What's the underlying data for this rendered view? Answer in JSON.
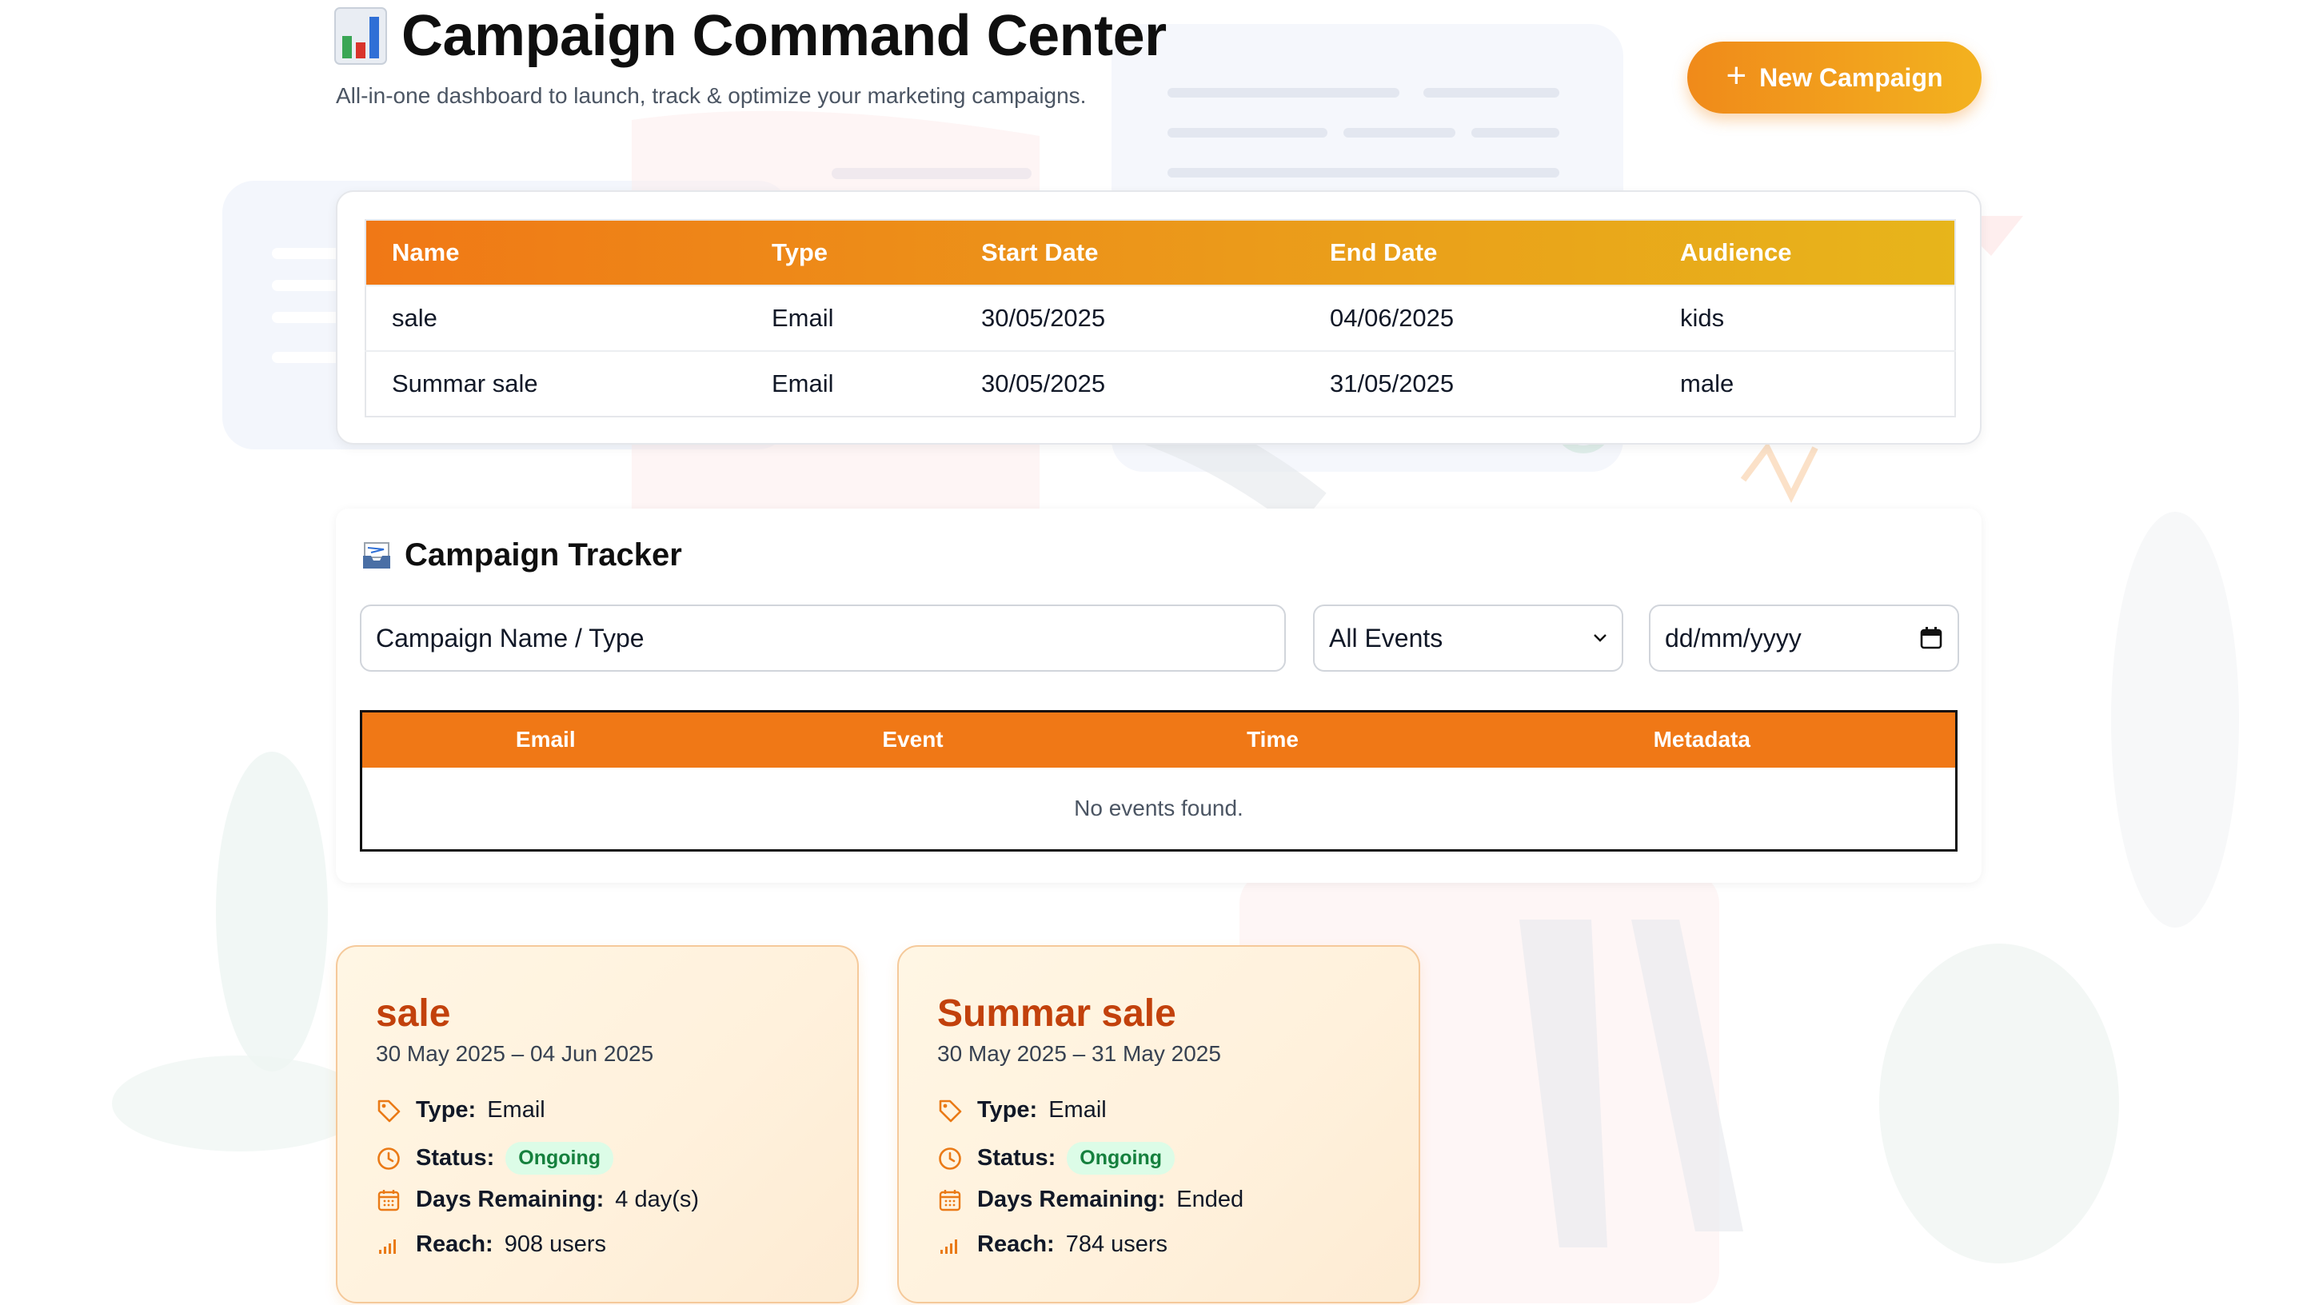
{
  "header": {
    "title": "Campaign Command Center",
    "subtitle": "All-in-one dashboard to launch, track & optimize your marketing campaigns.",
    "new_button": "New Campaign"
  },
  "campaigns_table": {
    "columns": [
      "Name",
      "Type",
      "Start Date",
      "End Date",
      "Audience"
    ],
    "rows": [
      [
        "sale",
        "Email",
        "30/05/2025",
        "04/06/2025",
        "kids"
      ],
      [
        "Summar sale",
        "Email",
        "30/05/2025",
        "31/05/2025",
        "male"
      ]
    ]
  },
  "tracker": {
    "title": "Campaign Tracker",
    "search_value": "Campaign Name / Type",
    "event_filter": "All Events",
    "date_value": "dd/mm/yyyy",
    "columns": [
      "Email",
      "Event",
      "Time",
      "Metadata"
    ],
    "empty_message": "No events found."
  },
  "cards": [
    {
      "name": "sale",
      "dates": "30 May 2025 – 04 Jun 2025",
      "type_label": "Type:",
      "type": "Email",
      "status_label": "Status:",
      "status": "Ongoing",
      "days_label": "Days Remaining:",
      "days": "4 day(s)",
      "reach_label": "Reach:",
      "reach": "908 users"
    },
    {
      "name": "Summar sale",
      "dates": "30 May 2025 – 31 May 2025",
      "type_label": "Type:",
      "type": "Email",
      "status_label": "Status:",
      "status": "Ongoing",
      "days_label": "Days Remaining:",
      "days": "Ended",
      "reach_label": "Reach:",
      "reach": "784 users"
    }
  ],
  "colors": {
    "accent": "#f07816",
    "accent_light": "#f3b21f",
    "card_title": "#c2410c",
    "badge_bg": "#dcfce7",
    "badge_text": "#15803d"
  }
}
